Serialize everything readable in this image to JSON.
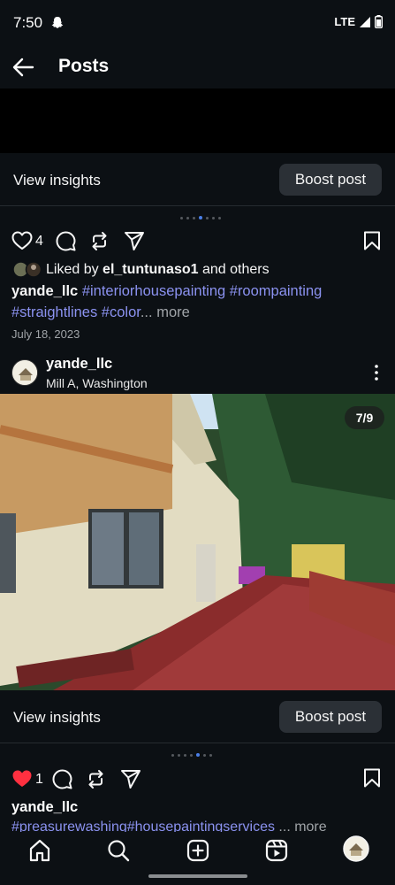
{
  "status_bar": {
    "time": "7:50",
    "network": "LTE",
    "icons": [
      "snapchat-ghost-icon",
      "signal-icon",
      "battery-icon"
    ]
  },
  "header": {
    "title": "Posts",
    "back_icon": "arrow-left-icon"
  },
  "post1_footer": {
    "insights_label": "View insights",
    "boost_label": "Boost post"
  },
  "post2": {
    "carousel_dots": {
      "count": 7,
      "active_index": 3
    },
    "likes": "4",
    "liked_by_prefix": "Liked by ",
    "liked_by_user": "el_tuntunaso1",
    "liked_by_suffix": " and others",
    "caption_user": "yande_llc",
    "caption_tags_line1": "#interiorhousepainting #roompainting",
    "caption_tags_line2": "#straightlines #color",
    "caption_ellipsis": "...",
    "more_label": " more",
    "date": "July 18, 2023"
  },
  "post3": {
    "user": "yande_llc",
    "location": "Mill A, Washington",
    "image_counter": "7/9",
    "insights_label": "View insights",
    "boost_label": "Boost post",
    "carousel_dots": {
      "count": 7,
      "active_index": 4
    },
    "likes": "1",
    "liked": true,
    "caption_user": "yande_llc",
    "caption_tags": "#preasurewashing#housepaintingservices",
    "more_label": "... more"
  },
  "bottom_nav": {
    "items": [
      "home-icon",
      "search-icon",
      "create-icon",
      "reels-icon",
      "profile-avatar"
    ]
  },
  "colors": {
    "background": "#0c1014",
    "hashtag": "#8b92f0",
    "heart_liked": "#ff3040",
    "dot_active": "#4a7fe8"
  }
}
